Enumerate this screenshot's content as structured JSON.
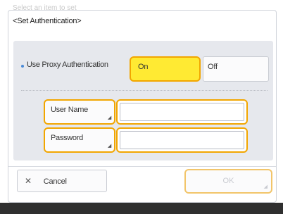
{
  "background": {
    "behind_title": "Select an item to set"
  },
  "dialog": {
    "title": "<Set Authentication>"
  },
  "proxy_auth": {
    "label": "Use Proxy Authentication",
    "on_label": "On",
    "off_label": "Off",
    "selected": "On"
  },
  "user_name": {
    "label": "User Name",
    "value": ""
  },
  "password": {
    "label": "Password",
    "value": ""
  },
  "footer": {
    "cancel_label": "Cancel",
    "ok_label": "OK"
  },
  "colors": {
    "accent_yellow": "#ffea33",
    "highlight_border": "#f2a600",
    "panel_bg": "#e6e8ed",
    "footer_bar": "#2f2f2f"
  }
}
